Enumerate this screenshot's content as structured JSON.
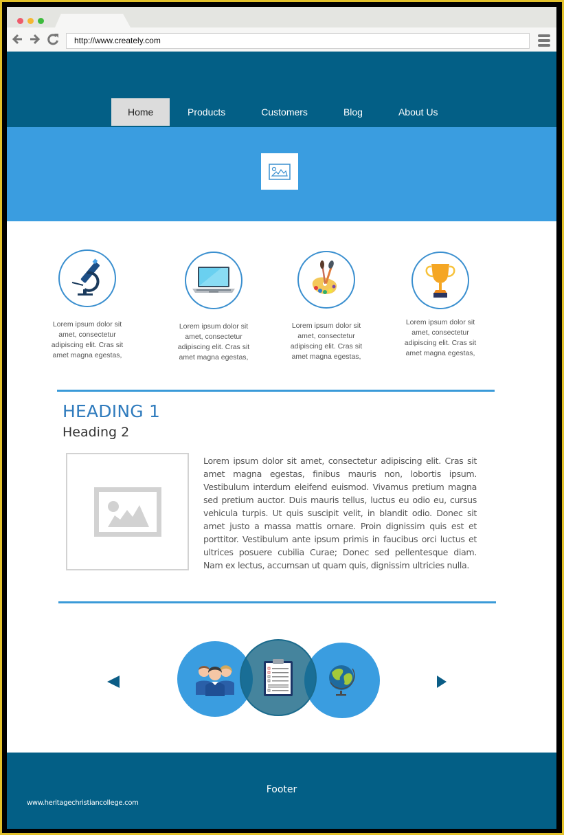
{
  "browser": {
    "url": "http://www.creately.com",
    "buttons": {
      "back": "back-arrow",
      "forward": "forward-arrow",
      "reload": "reload",
      "menu": "hamburger-menu"
    }
  },
  "nav": {
    "items": [
      {
        "label": "Home",
        "active": true
      },
      {
        "label": "Products",
        "active": false
      },
      {
        "label": "Customers",
        "active": false
      },
      {
        "label": "Blog",
        "active": false
      },
      {
        "label": "About Us",
        "active": false
      }
    ]
  },
  "hero": {
    "icon": "image-placeholder-icon"
  },
  "features": [
    {
      "icon": "microscope-icon",
      "text": "Lorem ipsum dolor sit amet, consectetur adipiscing elit. Cras sit amet magna egestas,"
    },
    {
      "icon": "laptop-icon",
      "text": "Lorem ipsum dolor sit amet, consectetur adipiscing elit. Cras sit amet magna egestas,"
    },
    {
      "icon": "paint-palette-icon",
      "text": "Lorem ipsum dolor sit amet, consectetur adipiscing elit. Cras sit amet magna egestas,"
    },
    {
      "icon": "trophy-icon",
      "text": "Lorem ipsum dolor sit amet, consectetur adipiscing elit. Cras sit amet magna egestas,"
    }
  ],
  "content": {
    "heading1": "HEADING 1",
    "heading2": "Heading 2",
    "paragraph": "Lorem ipsum dolor sit amet, consectetur adipiscing elit. Cras sit amet magna egestas, finibus mauris non, lobortis ipsum. Vestibulum interdum eleifend euismod. Vivamus pretium magna sed pretium auctor. Duis mauris tellus, luctus eu odio eu, cursus vehicula turpis. Ut quis suscipit velit, in blandit odio. Donec sit amet justo a massa mattis ornare. Proin dignissim quis est et porttitor. Vestibulum ante ipsum primis in faucibus orci luctus et ultrices posuere cubilia Curae; Donec sed pellentesque diam. Nam ex lectus, accumsan ut quam quis, dignissim ultricies nulla."
  },
  "carousel": {
    "slides": [
      {
        "icon": "people-group-icon"
      },
      {
        "icon": "clipboard-checklist-icon",
        "active": true
      },
      {
        "icon": "globe-icon"
      }
    ]
  },
  "footer": {
    "label": "Footer",
    "url": "www.heritagechristiancollege.com"
  },
  "colors": {
    "header": "#035f86",
    "hero": "#3a9de0",
    "accent": "#3a9ad8",
    "heading": "#2f7bbd",
    "frame": "#e2c12a"
  }
}
